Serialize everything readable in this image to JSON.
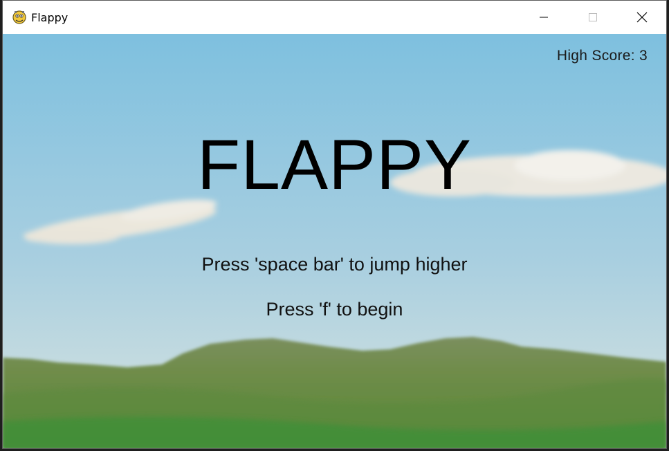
{
  "window": {
    "title": "Flappy",
    "icon": "pygame-snake-icon",
    "controls": [
      "minimize-icon",
      "maximize-icon",
      "close-icon"
    ]
  },
  "game": {
    "high_score_label": "High Score: 3",
    "title": "FLAPPY",
    "instruction_jump": "Press 'space bar' to jump higher",
    "instruction_start": "Press 'f' to begin"
  },
  "colors": {
    "sky_top": "#7ec0df",
    "sky_bottom": "#c9dde0",
    "hills": "#6f8f4a",
    "grass": "#3f8f38"
  }
}
